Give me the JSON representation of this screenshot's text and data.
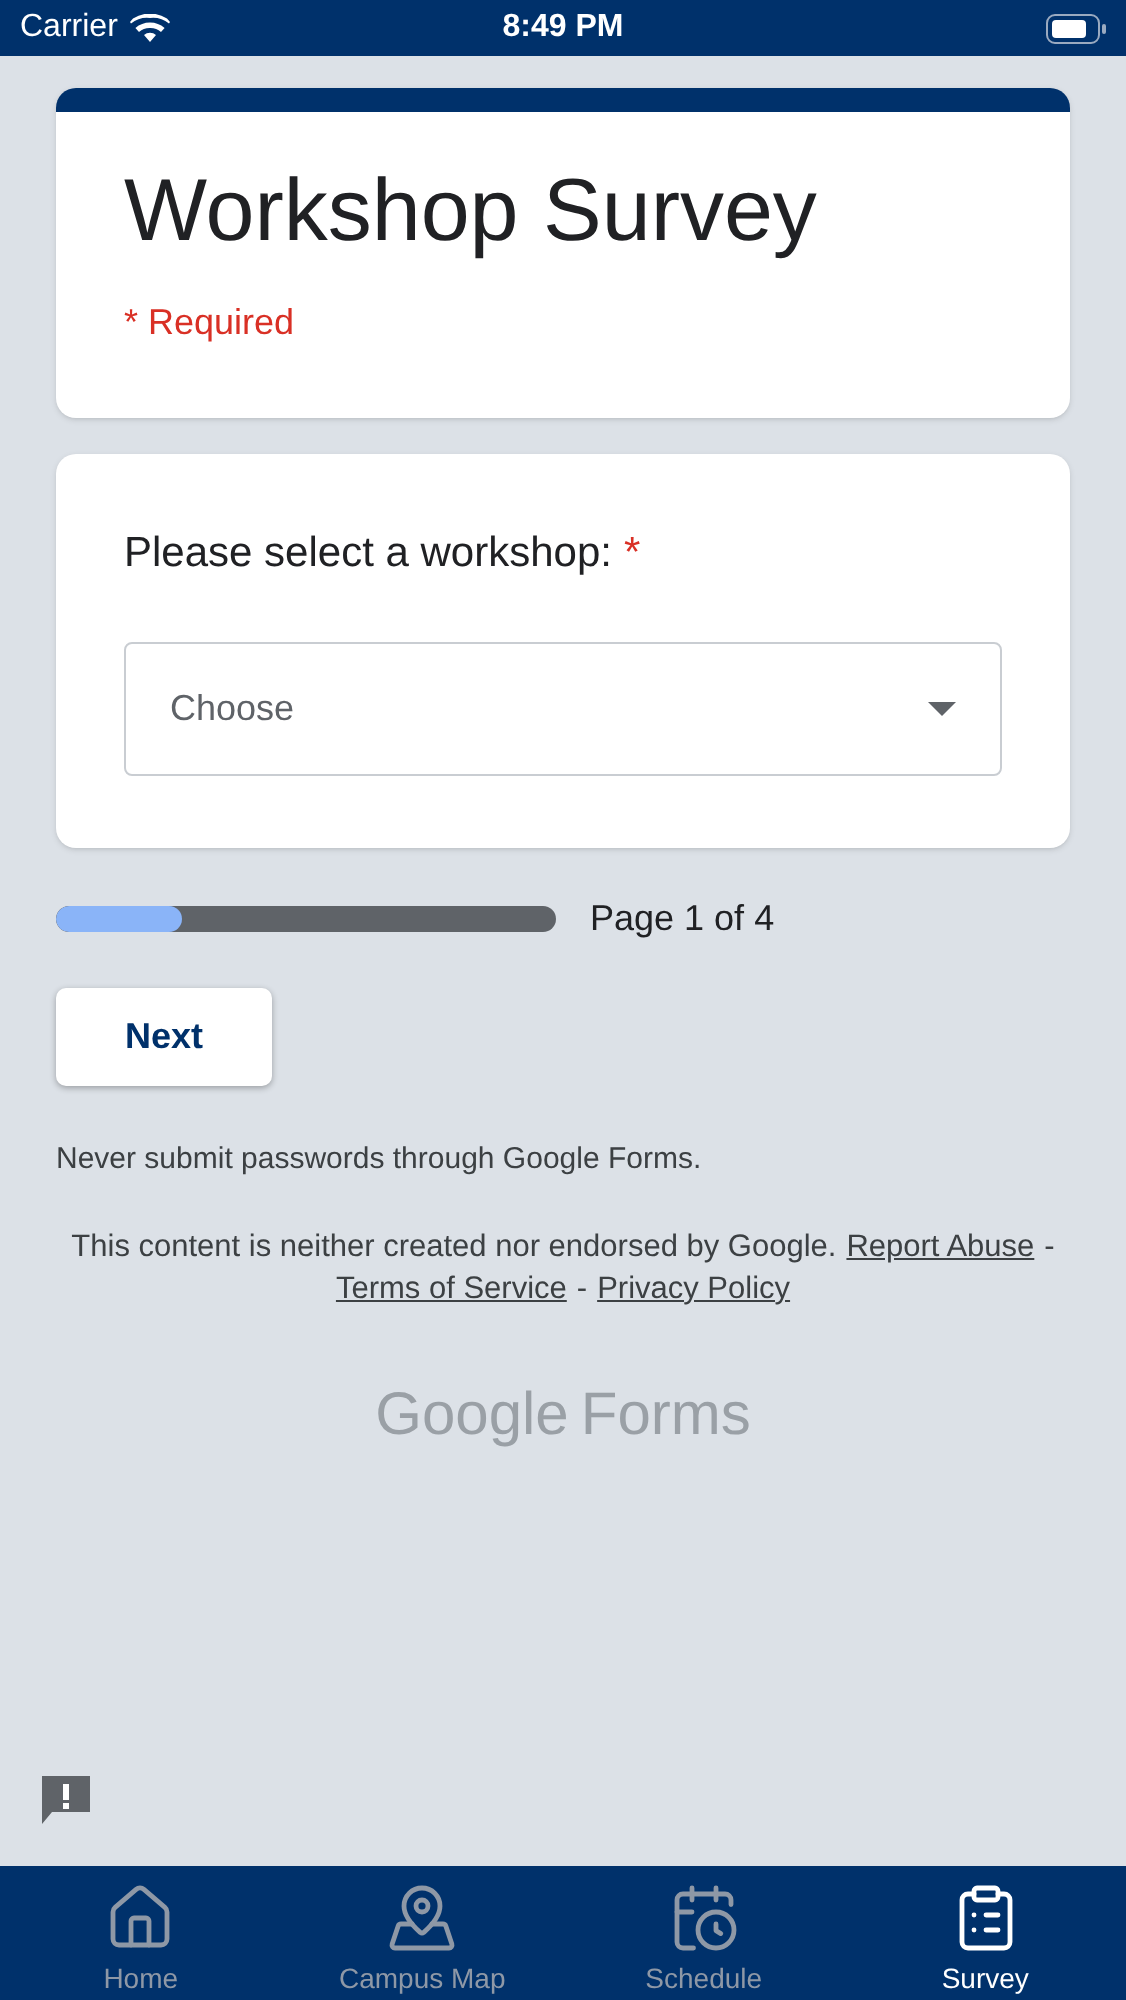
{
  "status_bar": {
    "carrier": "Carrier",
    "time": "8:49 PM"
  },
  "header_card": {
    "title": "Workshop Survey",
    "required_note": "* Required"
  },
  "question": {
    "label": "Please select a workshop:",
    "required_mark": "*",
    "dropdown": {
      "placeholder": "Choose"
    }
  },
  "progress": {
    "level": 0.25,
    "label": "Page 1 of 4"
  },
  "next_button": "Next",
  "warning": "Never submit passwords through Google Forms.",
  "footer": {
    "disclaimer": "This content is neither created nor endorsed by Google.",
    "links": [
      "Report Abuse",
      "Terms of Service",
      "Privacy Policy"
    ],
    "separator": "-"
  },
  "logo": {
    "brand": "Google",
    "product": "Forms"
  },
  "tabs": [
    {
      "label": "Home",
      "kind": "home",
      "selected": false
    },
    {
      "label": "Campus Map",
      "kind": "map",
      "selected": false
    },
    {
      "label": "Schedule",
      "kind": "schedule",
      "selected": false
    },
    {
      "label": "Survey",
      "kind": "survey",
      "selected": true
    }
  ]
}
